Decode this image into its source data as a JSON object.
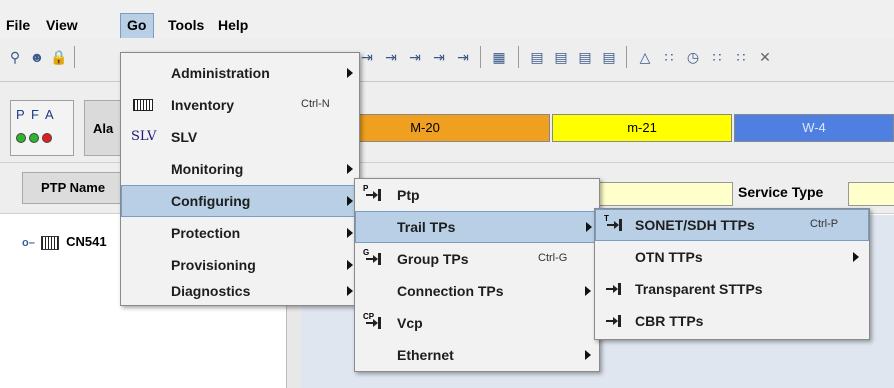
{
  "menubar": {
    "file": "File",
    "view": "View",
    "go": "Go",
    "tools": "Tools",
    "help": "Help"
  },
  "status": {
    "pfa_p": "P",
    "pfa_f": "F",
    "pfa_a": "A",
    "alarm_label": "Ala",
    "bars": [
      "M-20",
      "m-21",
      "W-4"
    ],
    "bar_colors": [
      "#f0a020",
      "#ffff00",
      "#4f7fe0"
    ]
  },
  "filter": {
    "ptp_name": "PTP Name",
    "service_type": "Service Type"
  },
  "tree": {
    "node": "CN541"
  },
  "go_menu": {
    "items": [
      {
        "label": "Administration",
        "icon": "",
        "accel": ""
      },
      {
        "label": "Inventory",
        "icon": "inventory-icon",
        "accel": "Ctrl-N"
      },
      {
        "label": "SLV",
        "icon": "SLV",
        "accel": ""
      },
      {
        "label": "Monitoring",
        "icon": "",
        "accel": ""
      },
      {
        "label": "Configuring",
        "icon": "",
        "accel": ""
      },
      {
        "label": "Protection",
        "icon": "",
        "accel": ""
      },
      {
        "label": "Provisioning",
        "icon": "",
        "accel": ""
      },
      {
        "label": "Diagnostics",
        "icon": "",
        "accel": ""
      }
    ]
  },
  "configuring_menu": {
    "items": [
      {
        "label": "Ptp",
        "icon": "P",
        "accel": ""
      },
      {
        "label": "Trail TPs",
        "icon": "",
        "accel": ""
      },
      {
        "label": "Group TPs",
        "icon": "G",
        "accel": "Ctrl-G"
      },
      {
        "label": "Connection TPs",
        "icon": "",
        "accel": ""
      },
      {
        "label": "Vcp",
        "icon": "CP",
        "accel": ""
      },
      {
        "label": "Ethernet",
        "icon": "",
        "accel": ""
      }
    ]
  },
  "trail_menu": {
    "items": [
      {
        "label": "SONET/SDH TTPs",
        "icon": "T",
        "accel": "Ctrl-P"
      },
      {
        "label": "OTN TTPs",
        "icon": "",
        "accel": ""
      },
      {
        "label": "Transparent STTPs",
        "icon": "",
        "accel": ""
      },
      {
        "label": "CBR TTPs",
        "icon": "",
        "accel": ""
      }
    ]
  }
}
